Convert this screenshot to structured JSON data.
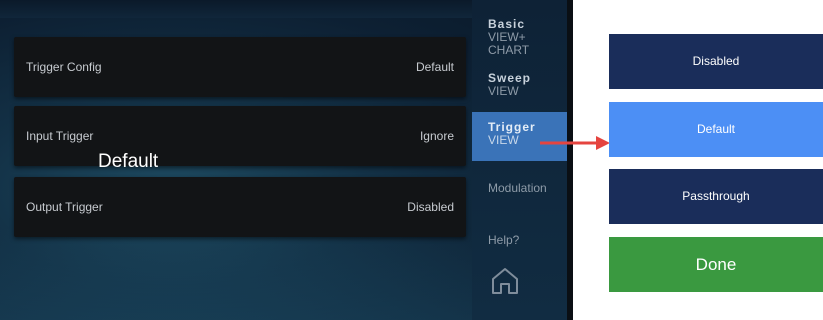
{
  "rows": [
    {
      "label": "Trigger Config",
      "value": "Default"
    },
    {
      "label": "Input Trigger",
      "value": "Ignore"
    },
    {
      "label": "Output Trigger",
      "value": "Disabled"
    }
  ],
  "overlay": {
    "text": "Default"
  },
  "sidebar": {
    "basic": {
      "title": "Basic",
      "sub1": "VIEW+",
      "sub2": "CHART"
    },
    "sweep": {
      "title": "Sweep",
      "sub": "VIEW"
    },
    "trigger": {
      "title": "Trigger",
      "sub": "VIEW"
    },
    "modulation": "Modulation",
    "help": "Help?"
  },
  "options": {
    "disabled": "Disabled",
    "default": "Default",
    "passthrough": "Passthrough",
    "done": "Done"
  },
  "colors": {
    "selected_option": "#4c8ff5",
    "option": "#1a2d5a",
    "done": "#3a9940",
    "arrow": "#e5443f",
    "active_sidebar": "#3a73b8"
  },
  "icons": {
    "home": "home-icon",
    "arrow": "arrow-right-icon"
  }
}
